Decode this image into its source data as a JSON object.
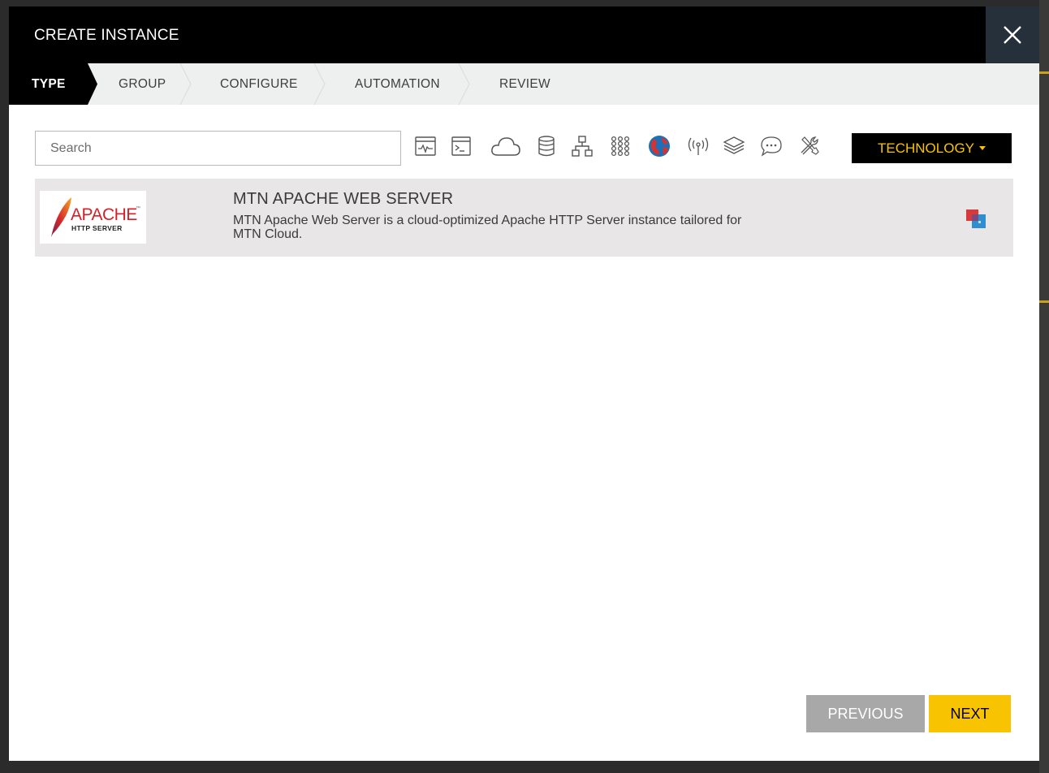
{
  "modal": {
    "title": "CREATE INSTANCE",
    "close_icon": "close-icon"
  },
  "wizard": {
    "steps": [
      {
        "label": "TYPE",
        "active": true
      },
      {
        "label": "GROUP",
        "active": false
      },
      {
        "label": "CONFIGURE",
        "active": false
      },
      {
        "label": "AUTOMATION",
        "active": false
      },
      {
        "label": "REVIEW",
        "active": false
      }
    ]
  },
  "search": {
    "placeholder": "Search",
    "value": ""
  },
  "filters": {
    "icons": [
      "monitoring-icon",
      "terminal-icon",
      "cloud-icon",
      "database-icon",
      "network-icon",
      "grid-icon",
      "globe-icon",
      "wireless-icon",
      "layers-icon",
      "chat-icon",
      "tools-icon"
    ]
  },
  "technology_button": {
    "label": "TECHNOLOGY"
  },
  "results": [
    {
      "logo_text": "APACHE",
      "logo_subtext": "HTTP SERVER",
      "title": "MTN APACHE WEB SERVER",
      "description": "MTN Apache Web Server is a cloud-optimized Apache HTTP Server instance tailored for MTN Cloud.",
      "badge_icon": "instance-type-icon"
    }
  ],
  "footer": {
    "previous_label": "PREVIOUS",
    "next_label": "NEXT"
  },
  "colors": {
    "header_bg": "#000000",
    "close_bg": "#26303a",
    "accent": "#f8c300",
    "row_bg": "#e8e6e7",
    "disabled_button": "#a8a8a8"
  }
}
